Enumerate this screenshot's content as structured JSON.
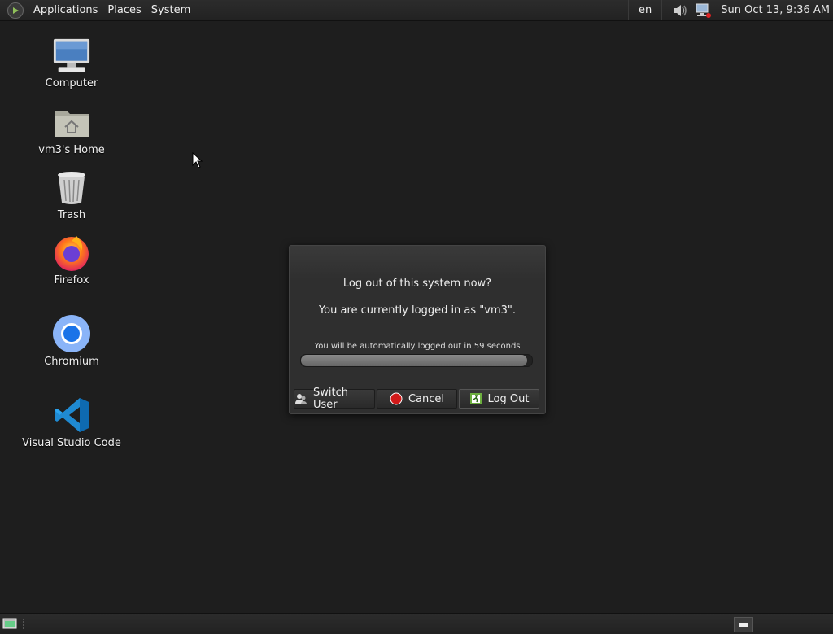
{
  "top_panel": {
    "menus": [
      "Applications",
      "Places",
      "System"
    ],
    "keyboard_layout": "en",
    "clock": "Sun Oct 13,  9:36 AM"
  },
  "desktop": {
    "icons": [
      {
        "label": "Computer",
        "icon": "computer-icon"
      },
      {
        "label": "vm3's Home",
        "icon": "home-folder-icon"
      },
      {
        "label": "Trash",
        "icon": "trash-icon"
      },
      {
        "label": "Firefox",
        "icon": "firefox-icon"
      },
      {
        "label": "Chromium",
        "icon": "chromium-icon"
      },
      {
        "label": "Visual Studio Code",
        "icon": "vscode-icon"
      }
    ]
  },
  "logout_dialog": {
    "title": "Log out of this system now?",
    "subtitle": "You are currently logged in as \"vm3\".",
    "timer_text": "You will be automatically logged out in 59 seconds",
    "progress": 0.98,
    "buttons": {
      "switch_user": "Switch User",
      "cancel": "Cancel",
      "log_out": "Log Out"
    }
  },
  "colors": {
    "desktop_bg": "#1e1e1e",
    "panel_bg": "#252525",
    "cancel_red": "#d11a1a",
    "logout_green": "#6cae3e"
  }
}
